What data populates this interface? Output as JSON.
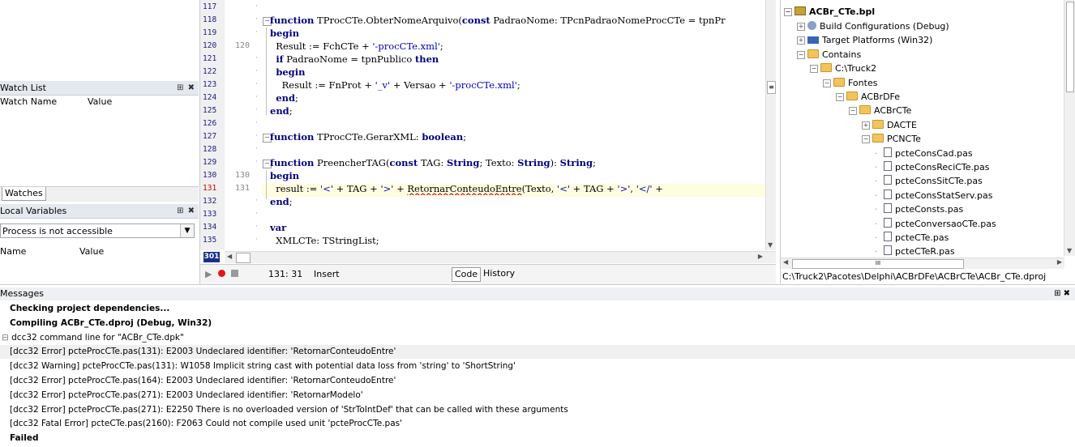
{
  "left": {
    "watch_list": {
      "title": "Watch List",
      "pin": "⊞ ✖",
      "col_name": "Watch Name",
      "col_value": "Value",
      "tab": "Watches"
    },
    "local_vars": {
      "title": "Local Variables",
      "pin": "⊞ ✖",
      "combo_value": "Process is not accessible",
      "col_name": "Name",
      "col_value": "Value"
    }
  },
  "editor": {
    "lines": [
      {
        "n": "117",
        "ln2": "",
        "text": ""
      },
      {
        "n": "118",
        "ln2": "",
        "text": "function TProcCTe.ObterNomeArquivo(const PadraoNome: TPcnPadraoNomeProcCTe = tpnPr"
      },
      {
        "n": "119",
        "ln2": "",
        "text": "begin"
      },
      {
        "n": "120",
        "ln2": "120",
        "text": "  Result := FchCTe + '-procCTe.xml';"
      },
      {
        "n": "121",
        "ln2": "",
        "text": "  if PadraoNome = tpnPublico then"
      },
      {
        "n": "122",
        "ln2": "",
        "text": "  begin"
      },
      {
        "n": "123",
        "ln2": "",
        "text": "    Result := FnProt + '_v' + Versao + '-procCTe.xml';"
      },
      {
        "n": "124",
        "ln2": "",
        "text": "  end;"
      },
      {
        "n": "125",
        "ln2": "",
        "text": "end;"
      },
      {
        "n": "126",
        "ln2": "",
        "text": ""
      },
      {
        "n": "127",
        "ln2": "",
        "text": "function TProcCTe.GerarXML: boolean;"
      },
      {
        "n": "128",
        "ln2": "",
        "text": ""
      },
      {
        "n": "129",
        "ln2": "",
        "text": "function PreencherTAG(const TAG: String; Texto: String): String;"
      },
      {
        "n": "130",
        "ln2": "130",
        "text": "begin"
      },
      {
        "n": "131",
        "ln2": "131",
        "text": "  result := '<' + TAG + '>' + RetornarConteudoEntre(Texto, '<' + TAG + '>', '</' +"
      },
      {
        "n": "132",
        "ln2": "",
        "text": "end;"
      },
      {
        "n": "133",
        "ln2": "",
        "text": ""
      },
      {
        "n": "134",
        "ln2": "",
        "text": "var"
      },
      {
        "n": "135",
        "ln2": "",
        "text": "  XMLCTe: TStringList;"
      }
    ],
    "current_line_badge": "301",
    "status": {
      "position": "131: 31",
      "mode": "Insert",
      "tab_code": "Code",
      "tab_history": "History"
    }
  },
  "project": {
    "root": "ACBr_CTe.bpl",
    "items": [
      {
        "label": "Build Configurations (Debug)",
        "kind": "gear"
      },
      {
        "label": "Target Platforms (Win32)",
        "kind": "platform"
      },
      {
        "label": "Contains",
        "kind": "folder"
      },
      {
        "label": "C:\\Truck2",
        "kind": "folder"
      },
      {
        "label": "Fontes",
        "kind": "folder"
      },
      {
        "label": "ACBrDFe",
        "kind": "folder"
      },
      {
        "label": "ACBrCTe",
        "kind": "folder"
      },
      {
        "label": "DACTE",
        "kind": "folder"
      },
      {
        "label": "PCNCTe",
        "kind": "folder"
      },
      {
        "label": "pcteConsCad.pas",
        "kind": "file"
      },
      {
        "label": "pcteConsReciCTe.pas",
        "kind": "file"
      },
      {
        "label": "pcteConsSitCTe.pas",
        "kind": "file"
      },
      {
        "label": "pcteConsStatServ.pas",
        "kind": "file"
      },
      {
        "label": "pcteConsts.pas",
        "kind": "file"
      },
      {
        "label": "pcteConversaoCTe.pas",
        "kind": "file"
      },
      {
        "label": "pcteCTe.pas",
        "kind": "file"
      },
      {
        "label": "pcteCTeR.pas",
        "kind": "file"
      }
    ],
    "path": "C:\\Truck2\\Pacotes\\Delphi\\ACBrDFe\\ACBrCTe\\ACBr_CTe.dproj"
  },
  "messages": {
    "title": "Messages",
    "pin": "⊞ ✖",
    "items": [
      {
        "text": "Checking project dependencies...",
        "bold": true
      },
      {
        "text": "Compiling ACBr_CTe.dproj (Debug, Win32)",
        "bold": true
      },
      {
        "text": "dcc32 command line for \"ACBr_CTe.dpk\"",
        "bold": false
      },
      {
        "text": "[dcc32 Error] pcteProcCTe.pas(131): E2003 Undeclared identifier: 'RetornarConteudoEntre'",
        "bold": false
      },
      {
        "text": "[dcc32 Warning] pcteProcCTe.pas(131): W1058 Implicit string cast with potential data loss from 'string' to 'ShortString'",
        "bold": false
      },
      {
        "text": "[dcc32 Error] pcteProcCTe.pas(164): E2003 Undeclared identifier: 'RetornarConteudoEntre'",
        "bold": false
      },
      {
        "text": "[dcc32 Error] pcteProcCTe.pas(271): E2003 Undeclared identifier: 'RetornarModelo'",
        "bold": false
      },
      {
        "text": "[dcc32 Error] pcteProcCTe.pas(271): E2250 There is no overloaded version of 'StrToIntDef' that can be called with these arguments",
        "bold": false
      },
      {
        "text": "[dcc32 Fatal Error] pcteCTe.pas(2160): F2063 Could not compile used unit 'pcteProcCTe.pas'",
        "bold": false
      },
      {
        "text": "Failed",
        "bold": true
      }
    ]
  }
}
